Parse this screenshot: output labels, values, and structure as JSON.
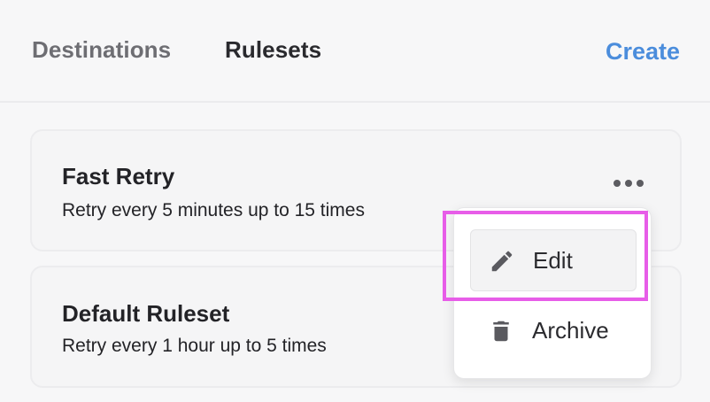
{
  "header": {
    "tabs": [
      {
        "label": "Destinations",
        "active": false
      },
      {
        "label": "Rulesets",
        "active": true
      }
    ],
    "create_label": "Create"
  },
  "rulesets": [
    {
      "name": "Fast Retry",
      "description": "Retry every 5 minutes up to 15 times"
    },
    {
      "name": "Default Ruleset",
      "description": "Retry every 1 hour up to 5 times"
    }
  ],
  "menu": {
    "items": [
      {
        "label": "Edit",
        "icon": "pencil-icon"
      },
      {
        "label": "Archive",
        "icon": "trash-icon"
      }
    ]
  },
  "colors": {
    "accent": "#4b8ddc",
    "highlight": "#e75de8",
    "text": "#232327",
    "muted": "#6e6e73"
  }
}
